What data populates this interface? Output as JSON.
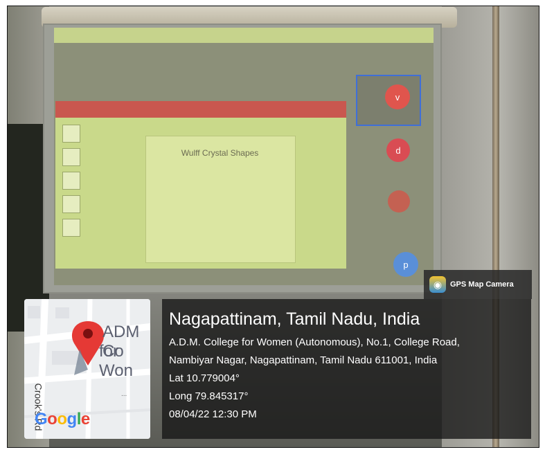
{
  "camera_badge": {
    "label": "GPS Map Camera",
    "icon": "map-pin-icon"
  },
  "map": {
    "place_label_1": "ADM Co",
    "place_label_2": "for Won",
    "road_label": "Crook's Rd",
    "brand": "Google",
    "pin_color": "#e53935"
  },
  "location": {
    "city": "Nagapattinam, Tamil Nadu, India",
    "address_line_1": "A.D.M. College for Women (Autonomous), No.1, College Road,",
    "address_line_2": "Nambiyar Nagar, Nagapattinam, Tamil Nadu 611001, India",
    "lat": "Lat 10.779004°",
    "long": "Long 79.845317°",
    "datetime": "08/04/22 12:30 PM"
  },
  "projected_slide": {
    "title": "Wulff Crystal Shapes"
  },
  "participants": [
    {
      "initial": "v"
    },
    {
      "initial": "d"
    },
    {
      "initial": ""
    },
    {
      "initial": "p"
    }
  ]
}
